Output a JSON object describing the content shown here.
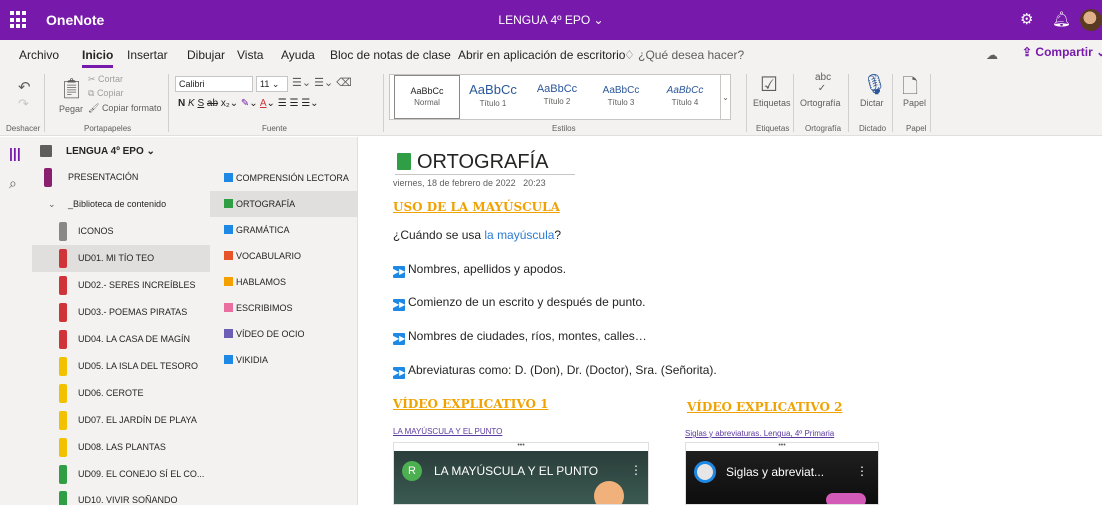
{
  "app": {
    "name": "OneNote",
    "title": "LENGUA 4º EPO"
  },
  "menu": {
    "items": [
      "Archivo",
      "Inicio",
      "Insertar",
      "Dibujar",
      "Vista",
      "Ayuda",
      "Bloc de notas de clase",
      "Abrir en aplicación de escritorio",
      "¿Qué desea hacer?"
    ],
    "active": "Inicio",
    "share": "Compartir"
  },
  "ribbon": {
    "undo_label": "Deshacer",
    "paste": "Pegar",
    "cut": "Cortar",
    "copy": "Copiar",
    "format_painter": "Copiar formato",
    "clipboard_label": "Portapapeles",
    "font_name": "Calibri",
    "font_size": "11",
    "font_label": "Fuente",
    "styles": [
      {
        "sample": "AaBbCc",
        "name": "Normal"
      },
      {
        "sample": "AaBbCc",
        "name": "Título 1"
      },
      {
        "sample": "AaBbCc",
        "name": "Título 2"
      },
      {
        "sample": "AaBbCc",
        "name": "Título 3"
      },
      {
        "sample": "AaBbCc",
        "name": "Título 4"
      }
    ],
    "styles_label": "Estilos",
    "tags": "Etiquetas",
    "spelling": "Ortografía",
    "dictate": "Dictar",
    "paper": "Papel",
    "tags_group": "Etiquetas",
    "spelling_group": "Ortografía",
    "dictation_group": "Dictado",
    "paper_group": "Papel"
  },
  "notebook": {
    "name": "LENGUA 4º EPO"
  },
  "sections": [
    {
      "label": "PRESENTACIÓN",
      "color": "#8b1e6f"
    },
    {
      "label": "_Biblioteca de contenido",
      "color": "",
      "group": true
    },
    {
      "label": "ICONOS",
      "color": "#8a8886"
    },
    {
      "label": "UD01. MI TÍO TEO",
      "color": "#d13438"
    },
    {
      "label": "UD02.- SERES INCREÍBLES",
      "color": "#d13438"
    },
    {
      "label": "UD03.- POEMAS PIRATAS",
      "color": "#d13438"
    },
    {
      "label": "UD04. LA CASA DE MAGÍN",
      "color": "#d13438"
    },
    {
      "label": "UD05. LA ISLA DEL TESORO",
      "color": "#f2c200"
    },
    {
      "label": "UD06. CEROTE",
      "color": "#f2c200"
    },
    {
      "label": "UD07. EL JARDÍN DE PLAYA",
      "color": "#f2c200"
    },
    {
      "label": "UD08. LAS PLANTAS",
      "color": "#f2c200"
    },
    {
      "label": "UD09. EL CONEJO SÍ EL CO...",
      "color": "#2f9e44"
    },
    {
      "label": "UD10. VIVIR SOÑANDO",
      "color": "#2f9e44"
    }
  ],
  "pages": [
    {
      "label": "COMPRENSIÓN LECTORA",
      "icon_color": "#1e88e5"
    },
    {
      "label": "ORTOGRAFÍA",
      "icon_color": "#2f9e44"
    },
    {
      "label": "GRAMÁTICA",
      "icon_color": "#1e88e5"
    },
    {
      "label": "VOCABULARIO",
      "icon_color": "#e8542a"
    },
    {
      "label": "HABLAMOS",
      "icon_color": "#f4a100"
    },
    {
      "label": "ESCRIBIMOS",
      "icon_color": "#e86fa0"
    },
    {
      "label": "VÍDEO DE OCIO",
      "icon_color": "#6b5fb5"
    },
    {
      "label": "VIKIDIA",
      "icon_color": "#1e88e5"
    }
  ],
  "page": {
    "title": "ORTOGRAFÍA",
    "date": "viernes, 18 de febrero de 2022",
    "time": "20:23",
    "section1_heading": "USO DE LA MAYÚSCULA",
    "question_prefix": "¿Cuándo se usa ",
    "question_highlight": "la mayúscula",
    "question_suffix": "?",
    "bullets": [
      "Nombres, apellidos y apodos.",
      "Comienzo de un escrito y después de punto.",
      "Nombres de ciudades, ríos, montes, calles…",
      "Abreviaturas como: D. (Don), Dr. (Doctor), Sra. (Señorita)."
    ],
    "video1_heading": "VÍDEO EXPLICATIVO 1",
    "video1_link": "LA MAYÚSCULA Y EL PUNTO",
    "video1_title": "LA MAYÚSCULA Y EL PUNTO",
    "video2_heading": "VÍDEO EXPLICATIVO 2",
    "video2_link": "Siglas y abreviaturas. Lengua, 4º Primaria",
    "video2_title": "Siglas y abreviat..."
  }
}
